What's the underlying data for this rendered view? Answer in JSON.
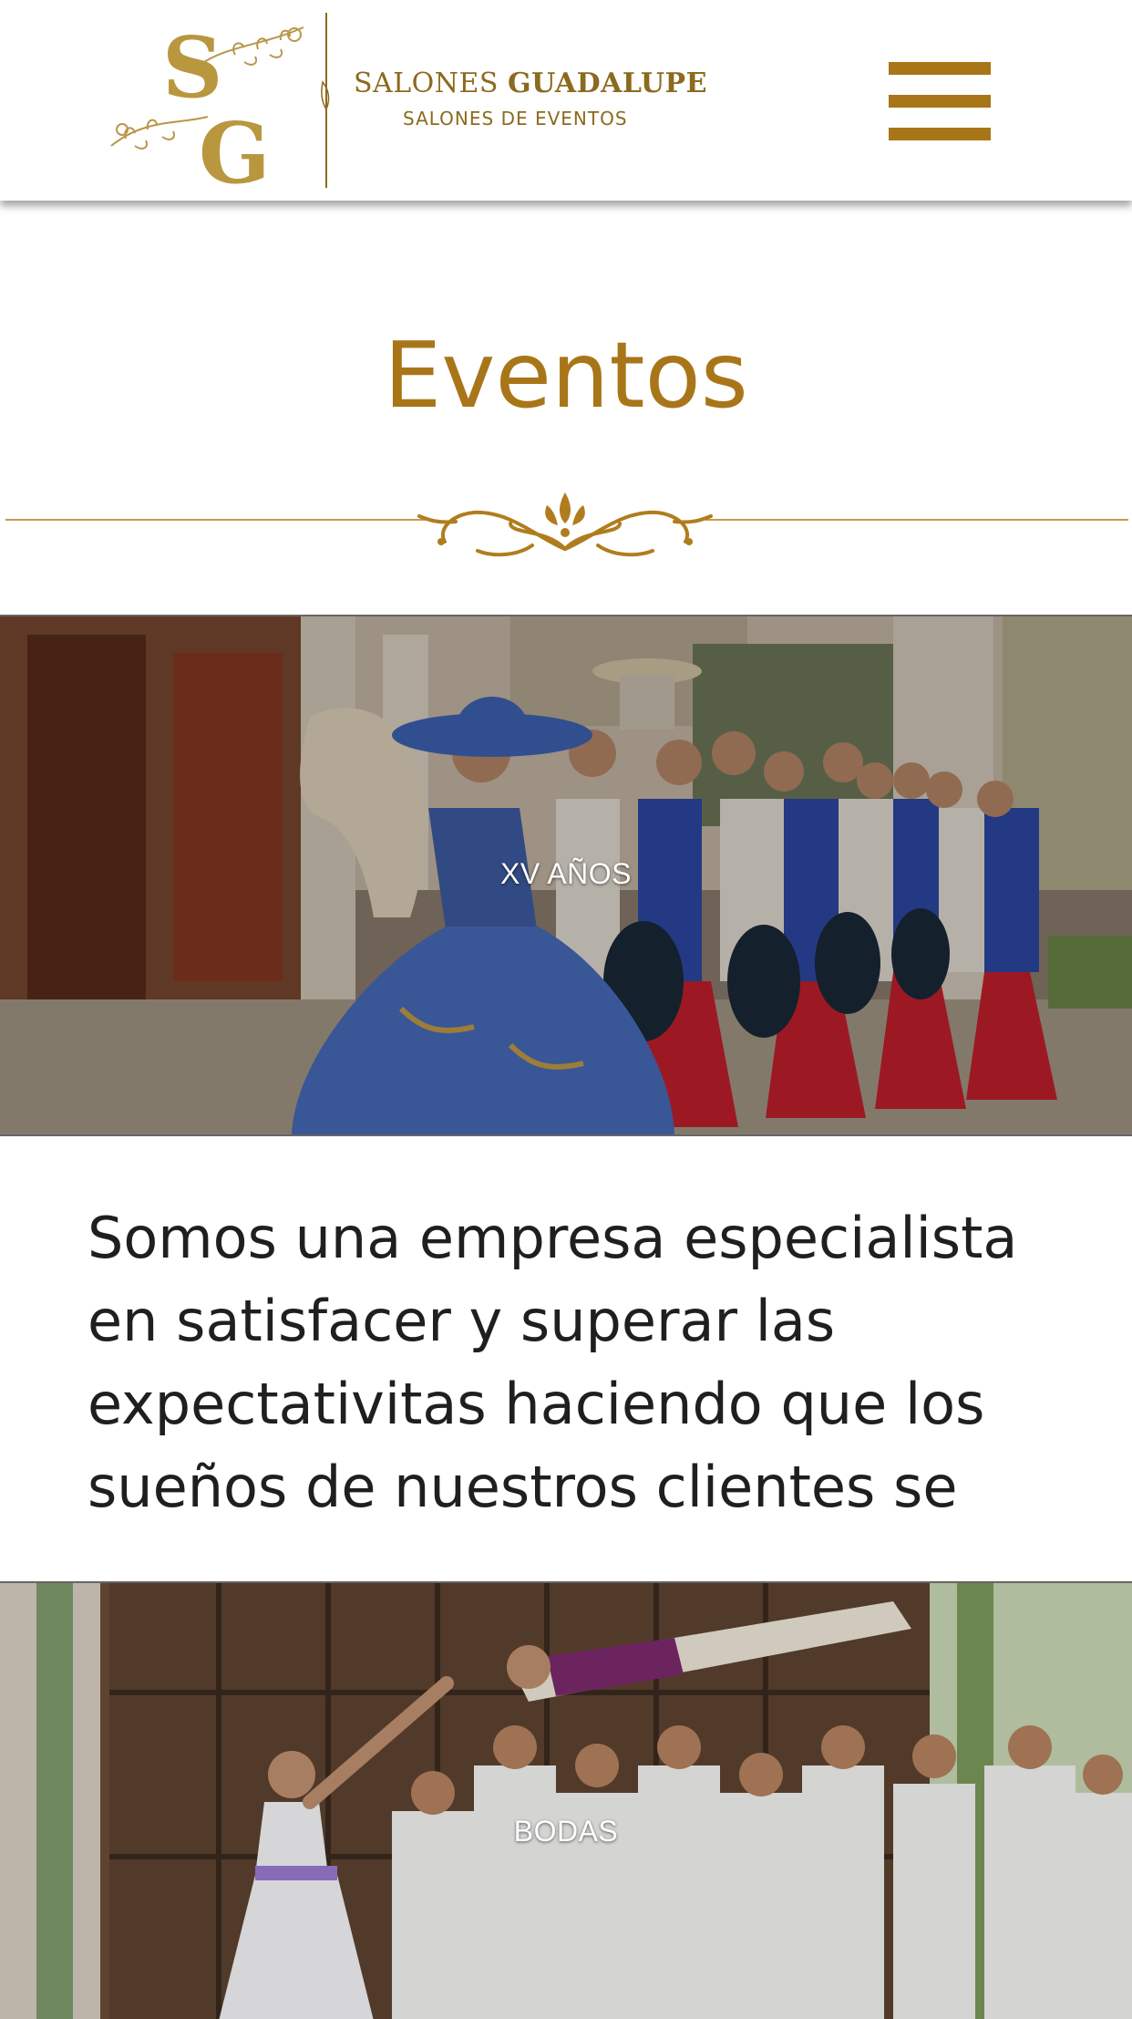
{
  "header": {
    "brand_name_light": "SALONES",
    "brand_name_bold": "GUADALUPE",
    "brand_tagline": "SALONES DE EVENTOS",
    "logo_monogram": "SG",
    "menu_icon": "hamburger-menu-icon"
  },
  "section": {
    "title": "Eventos"
  },
  "events": [
    {
      "label": "XV AÑOS"
    },
    {
      "label": "BODAS"
    }
  ],
  "intro": {
    "text": "Somos una empresa especialista en satisfacer y superar las expectativitas haciendo que los sueños de nuestros clientes se"
  },
  "colors": {
    "gold": "#a87619",
    "text": "#1f1f1f",
    "background": "#ffffff"
  }
}
